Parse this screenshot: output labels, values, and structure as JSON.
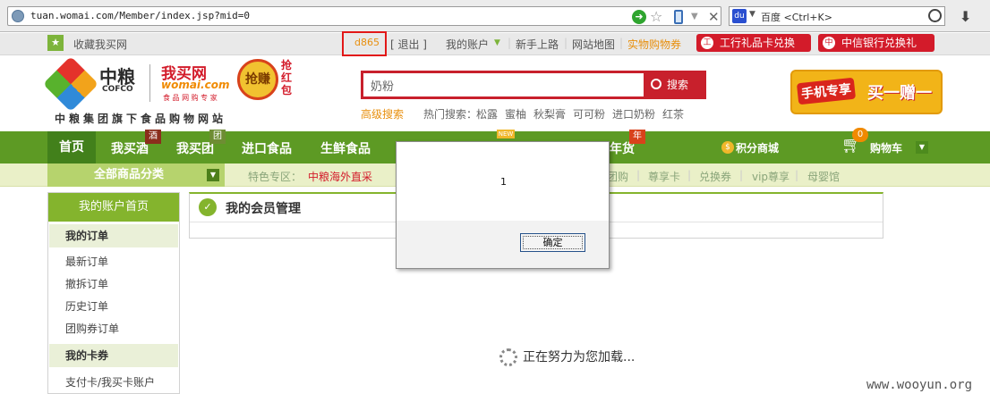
{
  "browser": {
    "url": "tuan.womai.com/Member/index.jsp?mid=0",
    "search_engine": "百度",
    "search_placeholder": "<Ctrl+K>",
    "icons": [
      "globe-icon",
      "go-icon",
      "star-icon",
      "phone-icon",
      "dropdown-icon",
      "stop-icon",
      "baidu-icon",
      "magnifier-icon",
      "download-icon"
    ]
  },
  "topbar": {
    "favorite": "收藏我买网",
    "username": "d865",
    "logout": "[ 退出 ]",
    "my_account": "我的账户",
    "newbie": "新手上路",
    "sitemap": "网站地图",
    "voucher": "实物购物券",
    "icbc": "工行礼品卡兑换",
    "citic": "中信银行兑换礼"
  },
  "header": {
    "logo_cn": "中粮",
    "logo_en": "COFCO",
    "brand_cn": "我买网",
    "brand_en": "womai.com",
    "brand_slogan": "食 品 网 购 专 家",
    "badge": "抢赚",
    "grab": "抢红包",
    "tagline": "中粮集团旗下食品购物网站",
    "search_value": "奶粉",
    "search_button": "搜索",
    "advanced": "高级搜索",
    "hot_label": "热门搜索：",
    "hot_terms": [
      "松露",
      "蜜柚",
      "秋梨膏",
      "可可粉",
      "进口奶粉",
      "红茶"
    ],
    "promo_a": "手机专享",
    "promo_b": "买一赠一"
  },
  "nav": {
    "items": [
      "首页",
      "我买酒",
      "我买团",
      "进口食品",
      "生鲜食品",
      "年货"
    ],
    "tag_jiu": "酒",
    "tag_tuan": "团",
    "tag_new": "NEW",
    "tag_nian": "年",
    "points": "积分商城",
    "cart": "购物车",
    "cart_count": "0"
  },
  "subnav": {
    "all_categories": "全部商品分类",
    "special_label": "特色专区：",
    "items": [
      "中粮海外直采",
      "团购",
      "尊享卡",
      "兑换券",
      "vip尊享",
      "母婴馆"
    ]
  },
  "sidebar": {
    "home": "我的账户首页",
    "orders_title": "我的订单",
    "orders": [
      "最新订单",
      "撤拆订单",
      "历史订单",
      "团购券订单"
    ],
    "cards_title": "我的卡券",
    "cards": [
      "支付卡/我买卡账户"
    ]
  },
  "main": {
    "title": "我的会员管理",
    "loading": "正在努力为您加载..."
  },
  "dialog": {
    "message": "1",
    "ok": "确定"
  },
  "watermark": "www.wooyun.org",
  "colors": {
    "accent_green": "#5d9a24",
    "brand_red": "#c8202c",
    "highlight_box": "#e21818"
  }
}
